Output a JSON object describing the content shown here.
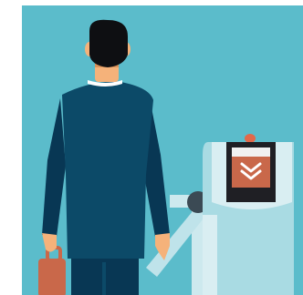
{
  "scene": {
    "subject": "businessman-at-airport-gate",
    "icons": {
      "person": "businessman-icon",
      "suitcase": "suitcase-icon",
      "gate": "boarding-gate-icon",
      "screen": "gate-screen-icon",
      "chevron": "double-chevron-down-icon"
    }
  },
  "palette": {
    "background": "#5bbccb",
    "suit": "#0c4a68",
    "suit_shadow": "#083754",
    "hair": "#0e0f12",
    "skin": "#f5b27a",
    "skin_shadow": "#d8925a",
    "shirt": "#ffffff",
    "suitcase": "#c9684a",
    "gate_body": "#a9dbe3",
    "gate_panel": "#d9eef2",
    "gate_rail": "#cde9ee",
    "arm_bar": "#bfe3ea",
    "arm_hub": "#3b4a54",
    "screen_frame": "#1f1f24",
    "screen_fill": "#c9684a",
    "screen_top": "#f1f1f1",
    "indicator": "#e2684a",
    "chevron": "#ffffff"
  }
}
